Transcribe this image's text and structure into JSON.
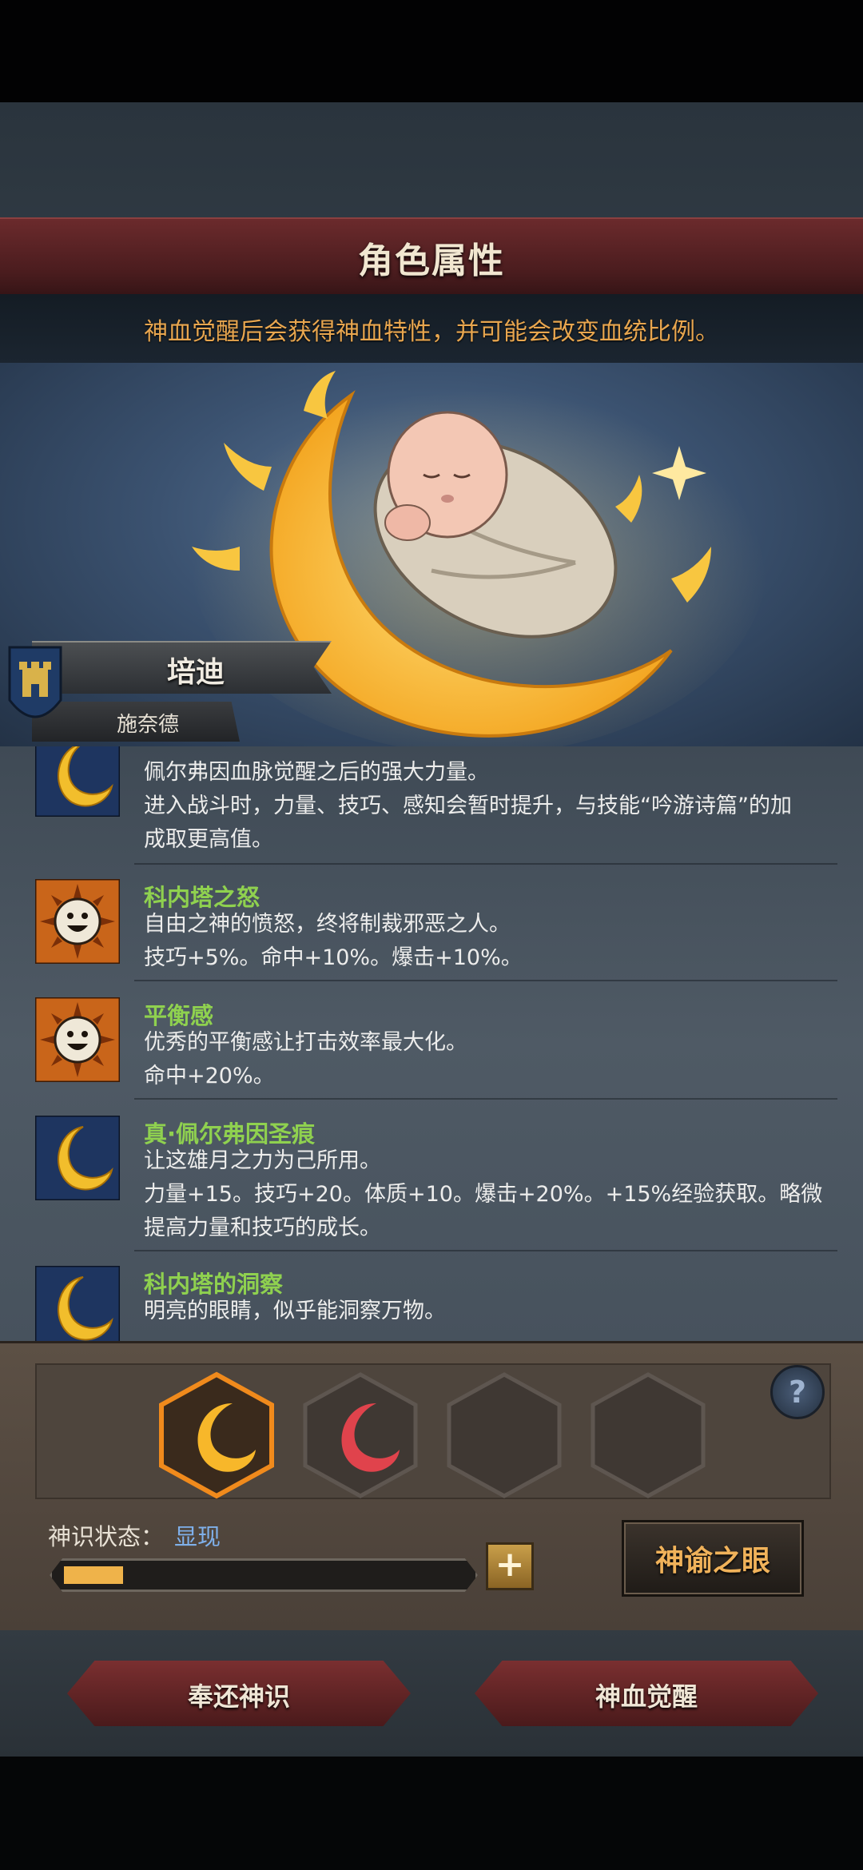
{
  "header": {
    "title": "角色属性",
    "subtitle": "神血觉醒后会获得神血特性，并可能会改变血统比例。"
  },
  "character": {
    "name": "培迪",
    "family": "施奈德"
  },
  "traits": [
    {
      "icon": "crescent-moon-icon",
      "name": "",
      "lines": [
        "佩尔弗因血脉觉醒之后的强大力量。",
        "进入战斗时，力量、技巧、感知会暂时提升，与技能“吟游诗篇”的加",
        "成取更高值。"
      ]
    },
    {
      "icon": "smiling-sun-icon",
      "name": "科内塔之怒",
      "lines": [
        "自由之神的愤怒，终将制裁邪恶之人。",
        "技巧+5%。命中+10%。爆击+10%。"
      ]
    },
    {
      "icon": "smiling-sun-icon",
      "name": "平衡感",
      "lines": [
        "优秀的平衡感让打击效率最大化。",
        "命中+20%。"
      ]
    },
    {
      "icon": "crescent-moon-icon",
      "name": "真·佩尔弗因圣痕",
      "lines": [
        "让这雄月之力为己所用。",
        "力量+15。技巧+20。体质+10。爆击+20%。+15%经验获取。略微",
        "提高力量和技巧的成长。"
      ]
    },
    {
      "icon": "crescent-moon-icon",
      "name": "科内塔的洞察",
      "lines": [
        "明亮的眼睛，似乎能洞察万物。"
      ]
    }
  ],
  "divine": {
    "status_label": "神识状态：",
    "status_value": "显现",
    "progress": 0.15,
    "plus_label": "+",
    "help_label": "?",
    "oracle_button": "神谕之眼"
  },
  "actions": {
    "return_button": "奉还神识",
    "awaken_button": "神血觉醒"
  },
  "colors": {
    "trait_name": "#8fd14f",
    "subtitle": "#e8a64f",
    "status_value": "#7fb0ea",
    "progress_fill": "#efb34a"
  }
}
